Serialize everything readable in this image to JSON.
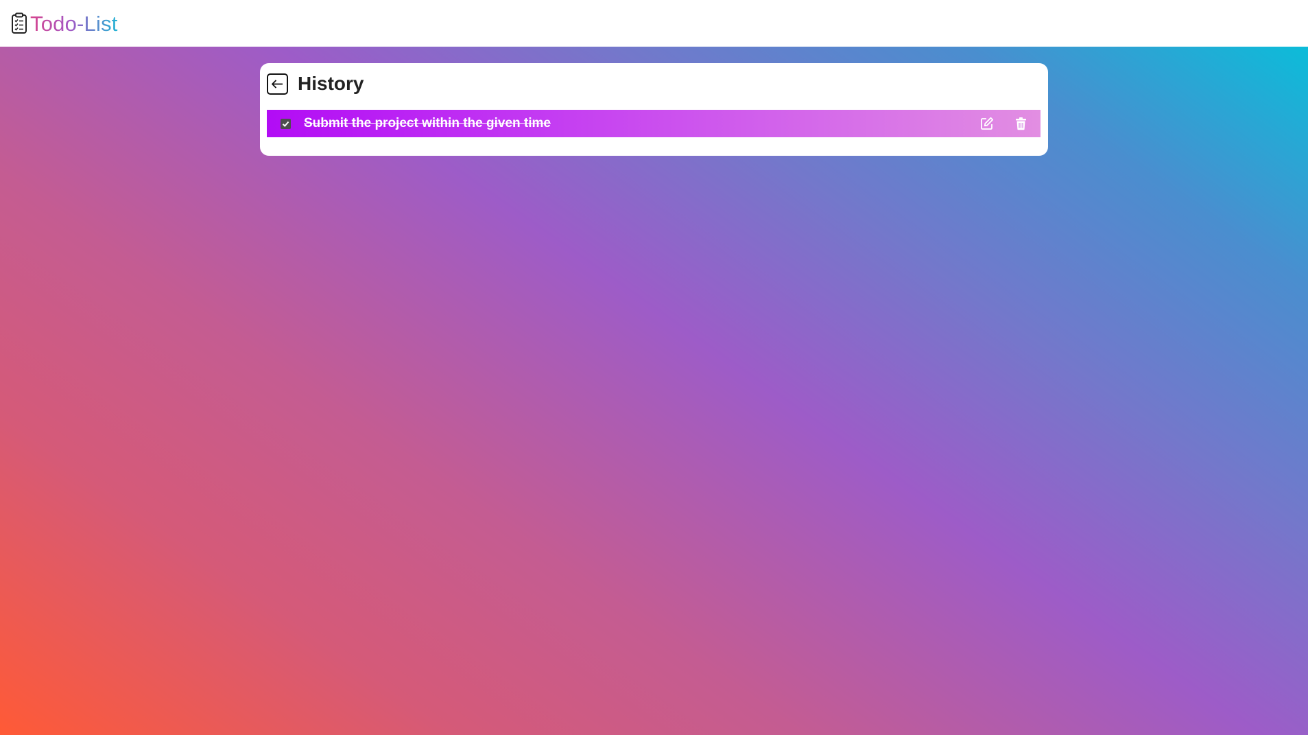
{
  "navbar": {
    "brand_text": "Todo-List",
    "brand_icon": "clipboard-list-icon"
  },
  "history_card": {
    "title": "History",
    "back_icon": "arrow-left-icon",
    "tasks": [
      {
        "text": "Submit the project within the given time",
        "completed": true,
        "edit_icon": "edit-icon",
        "delete_icon": "trash-icon"
      }
    ]
  },
  "colors": {
    "background_gradient_start": "#ff5a36",
    "background_gradient_mid": "#9d5cc8",
    "background_gradient_end": "#0cbcd9",
    "task_row_start": "#b20cf5",
    "task_row_end": "#e28ee2",
    "brand_text_start": "#d6458e",
    "brand_text_end": "#1fb4d4"
  }
}
